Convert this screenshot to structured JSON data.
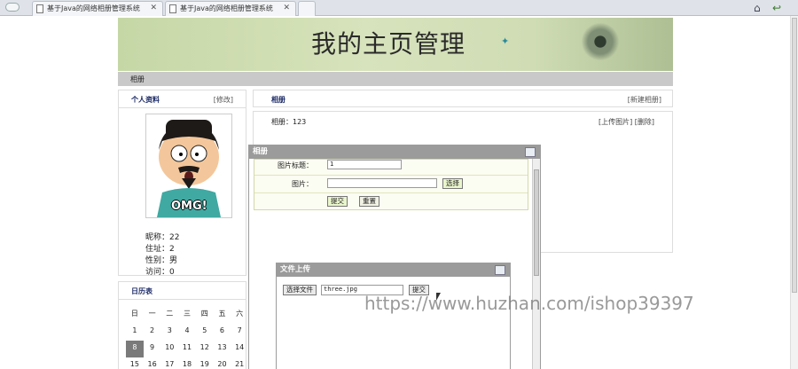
{
  "browser": {
    "tabs": [
      {
        "title": "基于Java的网络相册管理系统"
      },
      {
        "title": "基于Java的网络相册管理系统"
      }
    ]
  },
  "header": {
    "title": "我的主页管理"
  },
  "nav": {
    "item": "相册"
  },
  "profile": {
    "title": "个人资料",
    "edit_label": "[修改]",
    "avatar_text": "OMG!",
    "nickname": "昵称：22",
    "address": "住址：2",
    "gender": "性别：男",
    "visits": "访问：0"
  },
  "calendar": {
    "title": "日历表",
    "weekdays": [
      "日",
      "一",
      "二",
      "三",
      "四",
      "五",
      "六"
    ],
    "weeks": [
      [
        "1",
        "2",
        "3",
        "4",
        "5",
        "6",
        "7"
      ],
      [
        "8",
        "9",
        "10",
        "11",
        "12",
        "13",
        "14"
      ],
      [
        "15",
        "16",
        "17",
        "18",
        "19",
        "20",
        "21"
      ]
    ],
    "today": "8"
  },
  "album": {
    "title": "相册",
    "new_label": "[新建相册]",
    "count": "相册：123",
    "upload_label": "[上传图片]",
    "delete_label": "[删除]"
  },
  "album_dialog": {
    "title": "相册",
    "pic_title_label": "图片标题：",
    "pic_title_value": "1",
    "image_label": "图片：",
    "choose_label": "选择",
    "submit_label": "提交",
    "reset_label": "重置"
  },
  "upload_dialog": {
    "title": "文件上传",
    "choose_file_label": "选择文件",
    "file_name": "three.jpg",
    "submit_label": "提交"
  },
  "watermark": "https://www.huzhan.com/ishop39397"
}
